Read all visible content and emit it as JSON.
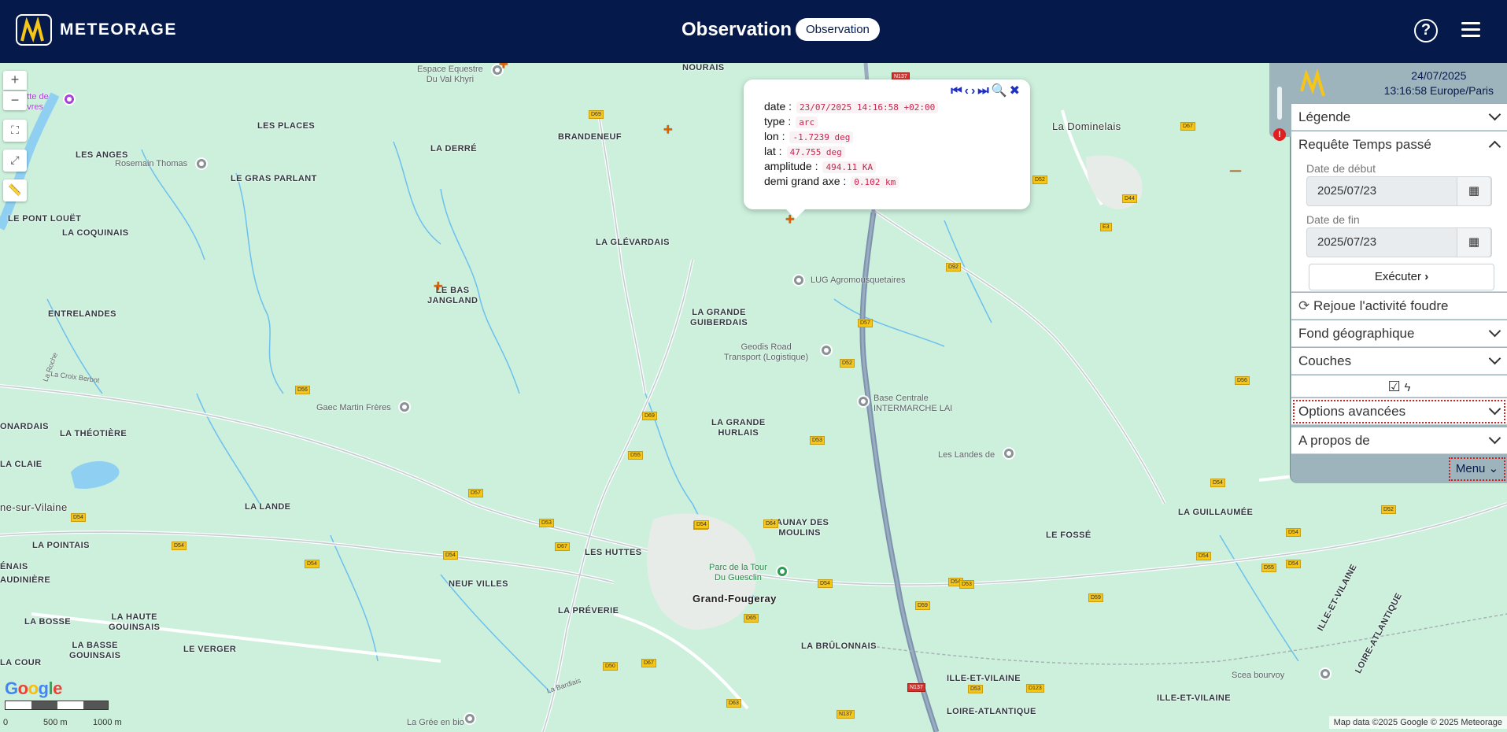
{
  "header": {
    "brand": "METEORAGE",
    "title": "Observation",
    "pill": "Observation",
    "help_icon": "help-circle-icon",
    "menu_icon": "hamburger-icon"
  },
  "map": {
    "controls": {
      "zoom_in": "+",
      "zoom_out": "−"
    },
    "places": {
      "nourais": "NOURAIS",
      "la_dominelais": "La Dominelais",
      "brandeneuf": "BRANDENEUF",
      "les_places": "LES PLACES",
      "la_derre": "LA DERRÉ",
      "les_anges": "LES ANGES",
      "le_gras_parlant": "LE GRAS PARLANT",
      "le_pont_louet": "LE PONT LOUËT",
      "la_coquinais": "LA COQUINAIS",
      "la_glevardais": "LA GLÉVARDAIS",
      "le_bas_jangland": "LE BAS\nJANGLAND",
      "entrelandes": "ENTRELANDES",
      "la_grande_guiberdais": "LA GRANDE\nGUIBERDAIS",
      "la_theotiere": "LA THÉOTIÈRE",
      "la_claie": "LA CLAIE",
      "la_grande_hurlais": "LA GRANDE\nHURLAIS",
      "la_lande": "LA LANDE",
      "launay_des_moulins": "LAUNAY DES\nMOULINS",
      "le_fosse": "LE FOSSÉ",
      "la_guillaumee": "LA GUILLAUMÉE",
      "la_pointais": "LA POINTAIS",
      "les_huttes": "LES HUTTES",
      "neuf_villes": "NEUF VILLES",
      "grand_fougeray": "Grand-Fougeray",
      "la_preverie": "LA PRÉVERIE",
      "la_bosse": "LA BOSSE",
      "la_haute_gouinsais": "LA HAUTE\nGOUINSAIS",
      "la_basse_gouinsais": "LA BASSE\nGOUINSAIS",
      "le_verger": "LE VERGER",
      "la_cour": "LA COUR",
      "la_brulonnais": "LA BRÛLONNAIS",
      "ille_et_vilaine": "ILLE-ET-VILAINE",
      "loire_atlantique": "LOIRE-ATLANTIQUE",
      "audiniere": "AUDINIÈRE",
      "enais": "ÉNAIS",
      "onardais": "ONARDAIS",
      "ne_sur_vilaine": "ne-sur-Vilaine",
      "ille_et_vilaine_diag": "ILLE-ET-VILAINE",
      "loire_atlantique_diag": "LOIRE-ATLANTIQUE"
    },
    "pois": {
      "espace_equestre": "Espace Equestre\nDu Val Khyri",
      "rosemain_thomas": "Rosemain Thomas",
      "grotte": "irotte de\nouvres",
      "lug": "LUG Agromousquetaires",
      "geodis": "Geodis Road\nTransport (Logistique)",
      "gaec": "Gaec Martin Frères",
      "base_centrale": "Base Centrale\nINTERMARCHE LAI",
      "les_landes": "Les Landes de",
      "parc": "Parc de la Tour\nDu Guesclin",
      "scea": "Scea bourvoy",
      "la_gree": "La Grée en bio",
      "la_bardiais": "La Bardiais",
      "la_roche": "La Roche",
      "la_croix_berbot": "La Croix Berbot"
    },
    "roads": [
      "N137",
      "D69",
      "D67",
      "D52",
      "D44",
      "D92",
      "D57",
      "E3",
      "D52",
      "D56",
      "D69",
      "D53",
      "D55",
      "D56",
      "D57",
      "D54",
      "D53",
      "D54",
      "D54",
      "D54",
      "D54",
      "D67",
      "D64",
      "D64",
      "D54",
      "D54",
      "D54",
      "D53",
      "D59",
      "D55",
      "N137",
      "D59",
      "D53",
      "D52",
      "D54",
      "D54",
      "D54",
      "D50",
      "D67",
      "D65",
      "D63",
      "N137",
      "D123"
    ],
    "attribution": "Map data ©2025 Google © 2025 Meteorage",
    "google_logo": "Google",
    "scale": {
      "zero": "0",
      "mid": "500 m",
      "end": "1000 m"
    }
  },
  "popup": {
    "nav_icons": [
      "first-icon",
      "prev-icon",
      "next-icon",
      "last-icon",
      "zoom-icon",
      "close-icon"
    ],
    "rows": [
      {
        "label": "date :",
        "value": "23/07/2025 14:16:58 +02:00"
      },
      {
        "label": "type :",
        "value": "arc"
      },
      {
        "label": "lon :",
        "value": "-1.7239 deg"
      },
      {
        "label": "lat :",
        "value": "47.755 deg"
      },
      {
        "label": "amplitude :",
        "value": "494.11 KA"
      },
      {
        "label": "demi grand axe :",
        "value": "0.102 km"
      }
    ]
  },
  "panel": {
    "date": "24/07/2025",
    "time": "13:16:58 Europe/Paris",
    "legende": "Légende",
    "requete": "Requête Temps passé",
    "date_debut_label": "Date de début",
    "date_debut_value": "2025/07/23",
    "date_fin_label": "Date de fin",
    "date_fin_value": "2025/07/23",
    "executer": "Exécuter",
    "rejoue": "Rejoue l'activité foudre",
    "fond": "Fond géographique",
    "couches": "Couches",
    "options": "Options avancées",
    "apropos": "A propos de",
    "menu": "Menu"
  },
  "colors": {
    "header_bg": "#051a4a",
    "map_bg": "#cdf0dc",
    "strike": "#e06000",
    "panel_bg": "#9db4bd"
  }
}
